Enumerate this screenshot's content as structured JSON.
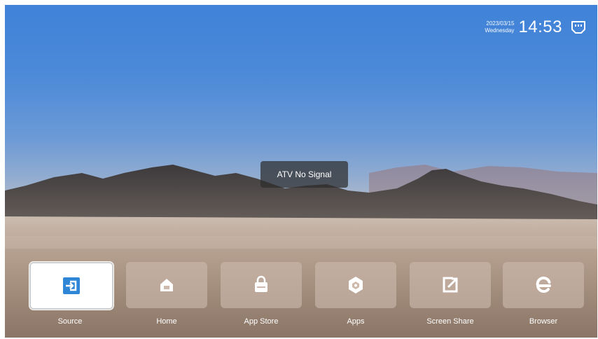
{
  "status": {
    "date": "2023/03/15",
    "weekday": "Wednesday",
    "time": "14:53",
    "network_icon": "ethernet-icon"
  },
  "toast": {
    "message": "ATV No Signal"
  },
  "dock": {
    "items": [
      {
        "label": "Source",
        "icon": "source-input-icon",
        "selected": true
      },
      {
        "label": "Home",
        "icon": "home-icon",
        "selected": false
      },
      {
        "label": "App Store",
        "icon": "store-bag-icon",
        "selected": false
      },
      {
        "label": "Apps",
        "icon": "apps-hexagon-icon",
        "selected": false
      },
      {
        "label": "Screen Share",
        "icon": "screen-share-icon",
        "selected": false
      },
      {
        "label": "Browser",
        "icon": "browser-e-icon",
        "selected": false
      }
    ]
  },
  "colors": {
    "accent": "#2f86d6",
    "tile_icon": "#ffffff"
  }
}
